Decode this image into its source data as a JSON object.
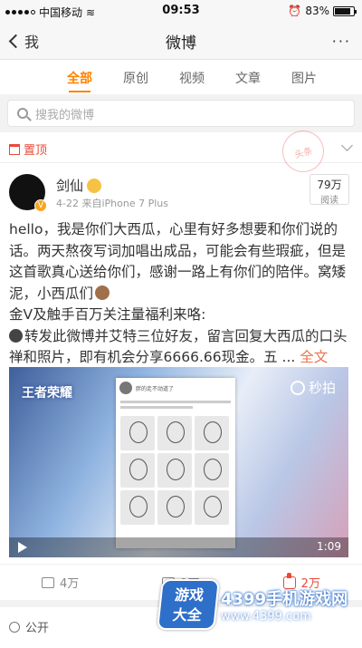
{
  "status_bar": {
    "carrier": "中国移动",
    "time": "09:53",
    "battery": "83%"
  },
  "nav": {
    "back_label": "我",
    "title": "微博",
    "more": "···"
  },
  "tabs": [
    {
      "label": "全部",
      "active": true
    },
    {
      "label": "原创",
      "active": false
    },
    {
      "label": "视频",
      "active": false
    },
    {
      "label": "文章",
      "active": false
    },
    {
      "label": "图片",
      "active": false
    }
  ],
  "search": {
    "placeholder": "搜我的微博"
  },
  "post": {
    "pin_label": "置顶",
    "stamp_text": "头条",
    "author": "剑仙",
    "meta": "4-22  来自iPhone 7 Plus",
    "reads_value": "79万",
    "reads_label": "阅读",
    "text_main": "hello，我是你们大西瓜，心里有好多想要和你们说的话。两天熬夜写词加唱出成品，可能会有些瑕疵，但是这首歌真心送给你们，感谢一路上有你们的陪伴。窝矮泥，小西瓜们",
    "text_line2": "金V及触手百万关注量福利来咯:",
    "text_line3": "转发此微博并艾特三位好友，留言回复大西瓜的口头禅和照片，即有机会分享6666.66现金。五 ...",
    "full_text_link": "全文",
    "video": {
      "game_logo": "王者荣耀",
      "provider": "秒拍",
      "duration": "1:09",
      "shot_caption": "胖的走不动道了"
    },
    "actions": {
      "share": "4万",
      "comment": "1万",
      "like": "2万"
    }
  },
  "next_post": {
    "visibility": "公开"
  },
  "watermark": {
    "logo_line1": "游戏",
    "logo_line2": "大全",
    "site_name": "4399手机游戏网",
    "url": "www.4399.com"
  },
  "colors": {
    "accent": "#ff8200",
    "pin_red": "#e94a3a",
    "link": "#eb7350"
  }
}
